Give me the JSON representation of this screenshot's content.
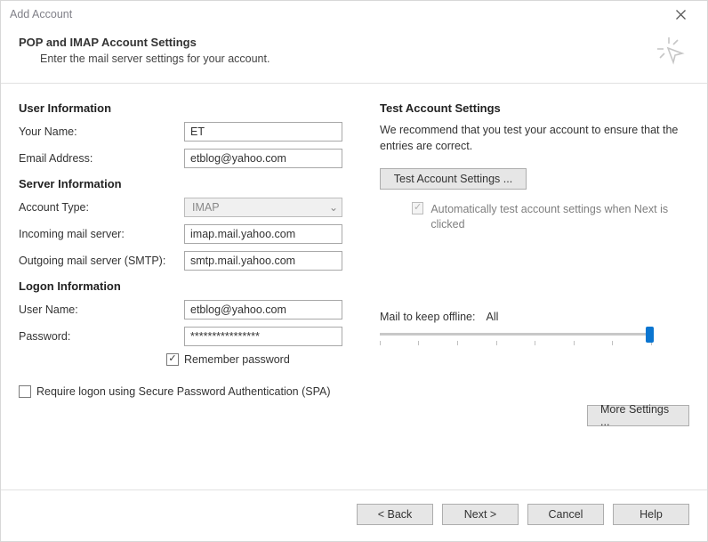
{
  "window": {
    "title": "Add Account"
  },
  "header": {
    "title": "POP and IMAP Account Settings",
    "subtitle": "Enter the mail server settings for your account."
  },
  "left": {
    "user_info": {
      "title": "User Information"
    },
    "your_name": {
      "label": "Your Name:",
      "value": "ET"
    },
    "email": {
      "label": "Email Address:",
      "value": "etblog@yahoo.com"
    },
    "server_info": {
      "title": "Server Information"
    },
    "account_type": {
      "label": "Account Type:",
      "value": "IMAP"
    },
    "incoming": {
      "label": "Incoming mail server:",
      "value": "imap.mail.yahoo.com"
    },
    "outgoing": {
      "label": "Outgoing mail server (SMTP):",
      "value": "smtp.mail.yahoo.com"
    },
    "logon_info": {
      "title": "Logon Information"
    },
    "username": {
      "label": "User Name:",
      "value": "etblog@yahoo.com"
    },
    "password": {
      "label": "Password:",
      "value": "****************"
    },
    "remember": {
      "label": "Remember password",
      "checked": true
    },
    "spa": {
      "label": "Require logon using Secure Password Authentication (SPA)",
      "checked": false
    }
  },
  "right": {
    "test_title": "Test Account Settings",
    "recommend": "We recommend that you test your account to ensure that the entries are correct.",
    "test_button": "Test Account Settings ...",
    "auto_test": {
      "label": "Automatically test account settings when Next is clicked"
    },
    "mail_offline": {
      "label": "Mail to keep offline:",
      "value": "All"
    },
    "more_settings": "More Settings ..."
  },
  "footer": {
    "back": "< Back",
    "next": "Next >",
    "cancel": "Cancel",
    "help": "Help"
  }
}
